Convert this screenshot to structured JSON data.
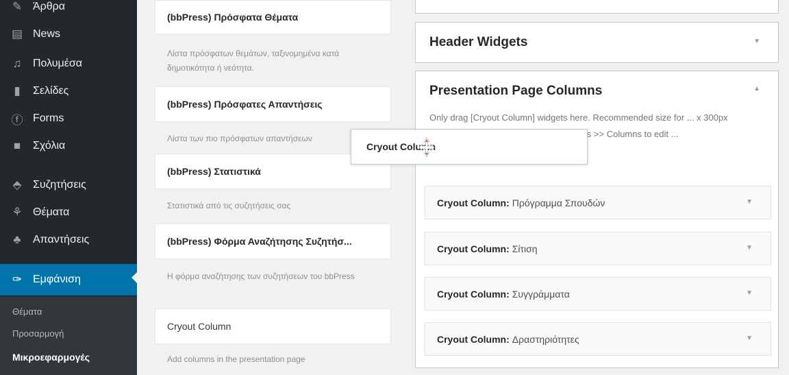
{
  "admin_menu": {
    "items": [
      {
        "label": "Άρθρα",
        "icon": "pushpin-icon"
      },
      {
        "label": "News",
        "icon": "news-icon"
      },
      {
        "label": "Πολυμέσα",
        "icon": "media-icon"
      },
      {
        "label": "Σελίδες",
        "icon": "pages-icon"
      },
      {
        "label": "Forms",
        "icon": "forms-icon"
      },
      {
        "label": "Σχόλια",
        "icon": "comments-icon"
      },
      {
        "label": "Συζητήσεις",
        "icon": "forums-icon"
      },
      {
        "label": "Θέματα",
        "icon": "topics-icon"
      },
      {
        "label": "Απαντήσεις",
        "icon": "replies-icon"
      },
      {
        "label": "Εμφάνιση",
        "icon": "appearance-icon"
      }
    ],
    "submenu": [
      {
        "label": "Θέματα"
      },
      {
        "label": "Προσαρμογή"
      },
      {
        "label": "Μικροεφαρμογές"
      }
    ]
  },
  "available_widgets": [
    {
      "title": "(bbPress) Πρόσφατα Θέματα",
      "description": "Λίστα πρόσφατων θεμάτων, ταξινομημένα κατά δημοτικότητα ή νεότητα."
    },
    {
      "title": "(bbPress) Πρόσφατες Απαντήσεις",
      "description": "Λίστα των πιο πρόσφατων απαντήσεων"
    },
    {
      "title": "(bbPress) Στατιστικά",
      "description": "Στατιστικά από τις συζητήσεις σας"
    },
    {
      "title": "(bbPress) Φόρμα Αναζήτησης Συζητήσ...",
      "description": "Η φόρμα αναζήτησης των συζητήσεων του bbPress"
    },
    {
      "title": "Cryout Column",
      "description": "Add columns in the presentation page"
    }
  ],
  "sidebars": {
    "header_widgets": {
      "title": "Header Widgets"
    },
    "presentation": {
      "title": "Presentation Page Columns",
      "description": "Only drag [Cryout Column] widgets here. Recommended size for ... x 300px (height). Go to the Nirvana ... ge Settings >> Columns to edit ...",
      "widgets": [
        {
          "name": "Cryout Column:",
          "title": "Πρόγραμμα Σπουδών"
        },
        {
          "name": "Cryout Column:",
          "title": "Σίτιση"
        },
        {
          "name": "Cryout Column:",
          "title": "Συγγράμματα"
        },
        {
          "name": "Cryout Column:",
          "title": "Δραστηριότητες"
        }
      ]
    }
  },
  "dragging_widget": {
    "label": "Cryout Column"
  },
  "arrows": {
    "down": "▼",
    "up": "▲"
  },
  "colors": {
    "sidebar_bg": "#23282d",
    "active": "#0073aa",
    "submenu_bg": "#32373c",
    "cursor_accent": "#d54e21"
  }
}
